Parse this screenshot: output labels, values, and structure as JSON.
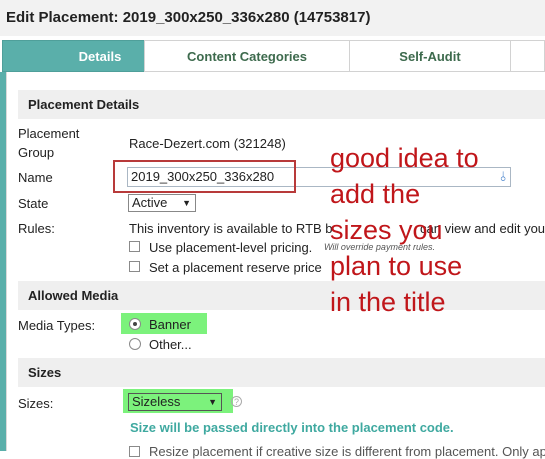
{
  "window": {
    "title": "Edit Placement: 2019_300x250_336x280 (14753817)"
  },
  "tabs": [
    {
      "label": "Details",
      "active": true
    },
    {
      "label": "Content Categories",
      "active": false
    },
    {
      "label": "Self-Audit",
      "active": false
    }
  ],
  "placement_details": {
    "heading": "Placement Details",
    "group_label_line1": "Placement",
    "group_label_line2": "Group",
    "group_value": "Race-Dezert.com (321248)",
    "name_label": "Name",
    "name_value": "2019_300x250_336x280",
    "state_label": "State",
    "state_value": "Active",
    "rules_label": "Rules:",
    "rules_text": "This inventory is available to RTB b",
    "rules_text_tail": "can view and edit your re",
    "pricing_label": "Use placement-level pricing.",
    "pricing_note": "Will override payment rules.",
    "reserve_label": "Set a placement reserve price"
  },
  "allowed_media": {
    "heading": "Allowed Media",
    "types_label": "Media Types:",
    "option_banner": "Banner",
    "option_other": "Other..."
  },
  "sizes": {
    "heading": "Sizes",
    "sizes_label": "Sizes:",
    "select_value": "Sizeless",
    "help_glyph": "?",
    "note": "Size will be passed directly into the placement code.",
    "truncated_next": "Resize placement if creative size is different from placement. Only ap"
  },
  "annotation": {
    "lines": [
      "good idea to",
      "add the",
      "sizes you",
      "plan to use",
      "in the title"
    ],
    "color": "#c0161a",
    "highlight_color": "#7cf27c",
    "tab_active_color": "#5aafaa"
  }
}
